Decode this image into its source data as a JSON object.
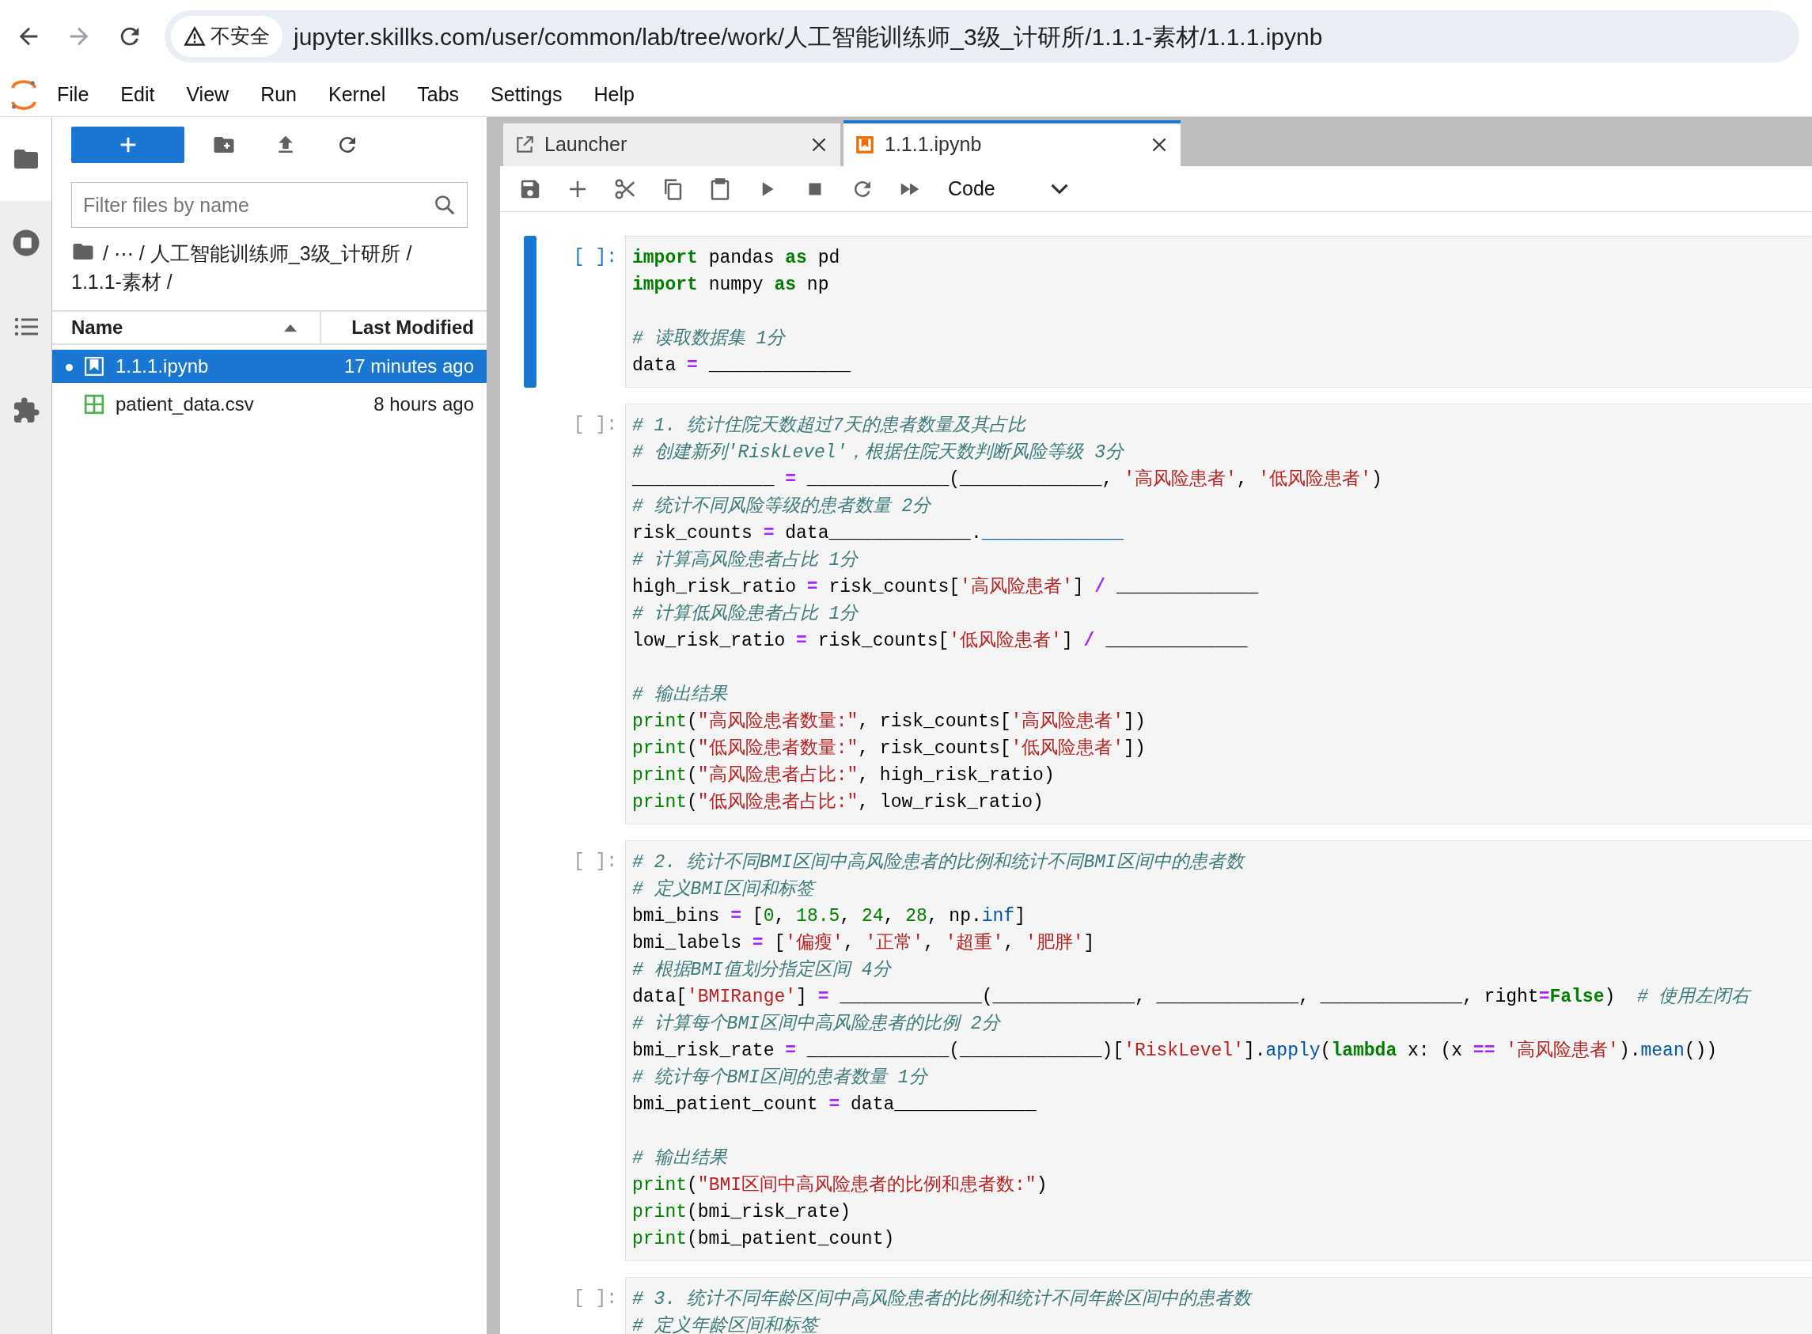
{
  "browser": {
    "security_label": "不安全",
    "url": "jupyter.skillks.com/user/common/lab/tree/work/人工智能训练师_3级_计研所/1.1.1-素材/1.1.1.ipynb"
  },
  "menu": [
    "File",
    "Edit",
    "View",
    "Run",
    "Kernel",
    "Tabs",
    "Settings",
    "Help"
  ],
  "file_browser": {
    "filter_placeholder": "Filter files by name",
    "breadcrumb": "/ ⋯ / 人工智能训练师_3级_计研所 / 1.1.1-素材 /",
    "columns": [
      {
        "label": "Name",
        "sorted": true
      },
      {
        "label": "Last Modified",
        "sorted": false
      }
    ],
    "files": [
      {
        "name": "1.1.1.ipynb",
        "modified": "17 minutes ago",
        "kind": "notebook",
        "selected": true,
        "open": true
      },
      {
        "name": "patient_data.csv",
        "modified": "8 hours ago",
        "kind": "csv",
        "selected": false,
        "open": false
      }
    ]
  },
  "tabs": [
    {
      "label": "Launcher",
      "kind": "launcher",
      "selected": false
    },
    {
      "label": "1.1.1.ipynb",
      "kind": "notebook",
      "selected": true
    }
  ],
  "toolbar": {
    "cell_type": "Code"
  },
  "cells": [
    {
      "prompt": "[ ]:",
      "active": true,
      "lines": [
        {
          "kind": "code",
          "tokens": [
            {
              "kind": "kw",
              "text": "import"
            },
            {
              "kind": "plain",
              "text": " pandas "
            },
            {
              "kind": "kw",
              "text": "as"
            },
            {
              "kind": "plain",
              "text": " pd"
            }
          ]
        },
        {
          "kind": "code",
          "tokens": [
            {
              "kind": "kw",
              "text": "import"
            },
            {
              "kind": "plain",
              "text": " numpy "
            },
            {
              "kind": "kw",
              "text": "as"
            },
            {
              "kind": "plain",
              "text": " np"
            }
          ]
        },
        {
          "kind": "blank"
        },
        {
          "kind": "code",
          "tokens": [
            {
              "kind": "comment",
              "text": "# 读取数据集 1分"
            }
          ]
        },
        {
          "kind": "code",
          "tokens": [
            {
              "kind": "plain",
              "text": "data "
            },
            {
              "kind": "op",
              "text": "="
            },
            {
              "kind": "plain",
              "text": " _____________"
            }
          ]
        }
      ]
    },
    {
      "prompt": "[ ]:",
      "active": false,
      "lines": [
        {
          "kind": "code",
          "tokens": [
            {
              "kind": "comment",
              "text": "# 1. 统计住院天数超过7天的患者数量及其占比"
            }
          ]
        },
        {
          "kind": "code",
          "tokens": [
            {
              "kind": "comment",
              "text": "# 创建新列'RiskLevel'，根据住院天数判断风险等级 3分"
            }
          ]
        },
        {
          "kind": "code",
          "tokens": [
            {
              "kind": "plain",
              "text": "_____________ "
            },
            {
              "kind": "op",
              "text": "="
            },
            {
              "kind": "plain",
              "text": " _____________(_____________, "
            },
            {
              "kind": "str",
              "text": "'高风险患者'"
            },
            {
              "kind": "plain",
              "text": ", "
            },
            {
              "kind": "str",
              "text": "'低风险患者'"
            },
            {
              "kind": "plain",
              "text": ")"
            }
          ]
        },
        {
          "kind": "code",
          "tokens": [
            {
              "kind": "comment",
              "text": "# 统计不同风险等级的患者数量 2分"
            }
          ]
        },
        {
          "kind": "code",
          "tokens": [
            {
              "kind": "plain",
              "text": "risk_counts "
            },
            {
              "kind": "op",
              "text": "="
            },
            {
              "kind": "plain",
              "text": " data_____________."
            },
            {
              "kind": "attr",
              "text": "_____________"
            }
          ]
        },
        {
          "kind": "code",
          "tokens": [
            {
              "kind": "comment",
              "text": "# 计算高风险患者占比 1分"
            }
          ]
        },
        {
          "kind": "code",
          "tokens": [
            {
              "kind": "plain",
              "text": "high_risk_ratio "
            },
            {
              "kind": "op",
              "text": "="
            },
            {
              "kind": "plain",
              "text": " risk_counts["
            },
            {
              "kind": "str",
              "text": "'高风险患者'"
            },
            {
              "kind": "plain",
              "text": "] "
            },
            {
              "kind": "op",
              "text": "/"
            },
            {
              "kind": "plain",
              "text": " _____________"
            }
          ]
        },
        {
          "kind": "code",
          "tokens": [
            {
              "kind": "comment",
              "text": "# 计算低风险患者占比 1分"
            }
          ]
        },
        {
          "kind": "code",
          "tokens": [
            {
              "kind": "plain",
              "text": "low_risk_ratio "
            },
            {
              "kind": "op",
              "text": "="
            },
            {
              "kind": "plain",
              "text": " risk_counts["
            },
            {
              "kind": "str",
              "text": "'低风险患者'"
            },
            {
              "kind": "plain",
              "text": "] "
            },
            {
              "kind": "op",
              "text": "/"
            },
            {
              "kind": "plain",
              "text": " _____________"
            }
          ]
        },
        {
          "kind": "blank"
        },
        {
          "kind": "code",
          "tokens": [
            {
              "kind": "comment",
              "text": "# 输出结果"
            }
          ]
        },
        {
          "kind": "code",
          "tokens": [
            {
              "kind": "call",
              "text": "print"
            },
            {
              "kind": "plain",
              "text": "("
            },
            {
              "kind": "str",
              "text": "\"高风险患者数量:\""
            },
            {
              "kind": "plain",
              "text": ", risk_counts["
            },
            {
              "kind": "str",
              "text": "'高风险患者'"
            },
            {
              "kind": "plain",
              "text": "])"
            }
          ]
        },
        {
          "kind": "code",
          "tokens": [
            {
              "kind": "call",
              "text": "print"
            },
            {
              "kind": "plain",
              "text": "("
            },
            {
              "kind": "str",
              "text": "\"低风险患者数量:\""
            },
            {
              "kind": "plain",
              "text": ", risk_counts["
            },
            {
              "kind": "str",
              "text": "'低风险患者'"
            },
            {
              "kind": "plain",
              "text": "])"
            }
          ]
        },
        {
          "kind": "code",
          "tokens": [
            {
              "kind": "call",
              "text": "print"
            },
            {
              "kind": "plain",
              "text": "("
            },
            {
              "kind": "str",
              "text": "\"高风险患者占比:\""
            },
            {
              "kind": "plain",
              "text": ", high_risk_ratio)"
            }
          ]
        },
        {
          "kind": "code",
          "tokens": [
            {
              "kind": "call",
              "text": "print"
            },
            {
              "kind": "plain",
              "text": "("
            },
            {
              "kind": "str",
              "text": "\"低风险患者占比:\""
            },
            {
              "kind": "plain",
              "text": ", low_risk_ratio)"
            }
          ]
        }
      ]
    },
    {
      "prompt": "[ ]:",
      "active": false,
      "lines": [
        {
          "kind": "code",
          "tokens": [
            {
              "kind": "comment",
              "text": "# 2. 统计不同BMI区间中高风险患者的比例和统计不同BMI区间中的患者数"
            }
          ]
        },
        {
          "kind": "code",
          "tokens": [
            {
              "kind": "comment",
              "text": "# 定义BMI区间和标签"
            }
          ]
        },
        {
          "kind": "code",
          "tokens": [
            {
              "kind": "plain",
              "text": "bmi_bins "
            },
            {
              "kind": "op",
              "text": "="
            },
            {
              "kind": "plain",
              "text": " ["
            },
            {
              "kind": "num",
              "text": "0"
            },
            {
              "kind": "plain",
              "text": ", "
            },
            {
              "kind": "num",
              "text": "18.5"
            },
            {
              "kind": "plain",
              "text": ", "
            },
            {
              "kind": "num",
              "text": "24"
            },
            {
              "kind": "plain",
              "text": ", "
            },
            {
              "kind": "num",
              "text": "28"
            },
            {
              "kind": "plain",
              "text": ", np."
            },
            {
              "kind": "attr",
              "text": "inf"
            },
            {
              "kind": "plain",
              "text": "]"
            }
          ]
        },
        {
          "kind": "code",
          "tokens": [
            {
              "kind": "plain",
              "text": "bmi_labels "
            },
            {
              "kind": "op",
              "text": "="
            },
            {
              "kind": "plain",
              "text": " ["
            },
            {
              "kind": "str",
              "text": "'偏瘦'"
            },
            {
              "kind": "plain",
              "text": ", "
            },
            {
              "kind": "str",
              "text": "'正常'"
            },
            {
              "kind": "plain",
              "text": ", "
            },
            {
              "kind": "str",
              "text": "'超重'"
            },
            {
              "kind": "plain",
              "text": ", "
            },
            {
              "kind": "str",
              "text": "'肥胖'"
            },
            {
              "kind": "plain",
              "text": "]"
            }
          ]
        },
        {
          "kind": "code",
          "tokens": [
            {
              "kind": "comment",
              "text": "# 根据BMI值划分指定区间 4分"
            }
          ]
        },
        {
          "kind": "code",
          "tokens": [
            {
              "kind": "plain",
              "text": "data["
            },
            {
              "kind": "str",
              "text": "'BMIRange'"
            },
            {
              "kind": "plain",
              "text": "] "
            },
            {
              "kind": "op",
              "text": "="
            },
            {
              "kind": "plain",
              "text": " _____________(_____________, _____________, _____________, right"
            },
            {
              "kind": "op",
              "text": "="
            },
            {
              "kind": "kw",
              "text": "False"
            },
            {
              "kind": "plain",
              "text": ")  "
            },
            {
              "kind": "comment",
              "text": "# 使用左闭右"
            }
          ]
        },
        {
          "kind": "code",
          "tokens": [
            {
              "kind": "comment",
              "text": "# 计算每个BMI区间中高风险患者的比例 2分"
            }
          ]
        },
        {
          "kind": "code",
          "tokens": [
            {
              "kind": "plain",
              "text": "bmi_risk_rate "
            },
            {
              "kind": "op",
              "text": "="
            },
            {
              "kind": "plain",
              "text": " _____________(_____________)["
            },
            {
              "kind": "str",
              "text": "'RiskLevel'"
            },
            {
              "kind": "plain",
              "text": "]."
            },
            {
              "kind": "attr",
              "text": "apply"
            },
            {
              "kind": "plain",
              "text": "("
            },
            {
              "kind": "kw",
              "text": "lambda"
            },
            {
              "kind": "plain",
              "text": " x: (x "
            },
            {
              "kind": "op",
              "text": "=="
            },
            {
              "kind": "str",
              "text": " '高风险患者'"
            },
            {
              "kind": "plain",
              "text": ")."
            },
            {
              "kind": "attr",
              "text": "mean"
            },
            {
              "kind": "plain",
              "text": "())"
            }
          ]
        },
        {
          "kind": "code",
          "tokens": [
            {
              "kind": "comment",
              "text": "# 统计每个BMI区间的患者数量 1分"
            }
          ]
        },
        {
          "kind": "code",
          "tokens": [
            {
              "kind": "plain",
              "text": "bmi_patient_count "
            },
            {
              "kind": "op",
              "text": "="
            },
            {
              "kind": "plain",
              "text": " data_____________"
            }
          ]
        },
        {
          "kind": "blank"
        },
        {
          "kind": "code",
          "tokens": [
            {
              "kind": "comment",
              "text": "# 输出结果"
            }
          ]
        },
        {
          "kind": "code",
          "tokens": [
            {
              "kind": "call",
              "text": "print"
            },
            {
              "kind": "plain",
              "text": "("
            },
            {
              "kind": "str",
              "text": "\"BMI区间中高风险患者的比例和患者数:\""
            },
            {
              "kind": "plain",
              "text": ")"
            }
          ]
        },
        {
          "kind": "code",
          "tokens": [
            {
              "kind": "call",
              "text": "print"
            },
            {
              "kind": "plain",
              "text": "(bmi_risk_rate)"
            }
          ]
        },
        {
          "kind": "code",
          "tokens": [
            {
              "kind": "call",
              "text": "print"
            },
            {
              "kind": "plain",
              "text": "(bmi_patient_count)"
            }
          ]
        }
      ]
    },
    {
      "prompt": "[ ]:",
      "active": false,
      "lines": [
        {
          "kind": "code",
          "tokens": [
            {
              "kind": "comment",
              "text": "# 3. 统计不同年龄区间中高风险患者的比例和统计不同年龄区间中的患者数"
            }
          ]
        },
        {
          "kind": "code",
          "tokens": [
            {
              "kind": "comment",
              "text": "# 定义年龄区间和标签"
            }
          ]
        }
      ]
    }
  ]
}
